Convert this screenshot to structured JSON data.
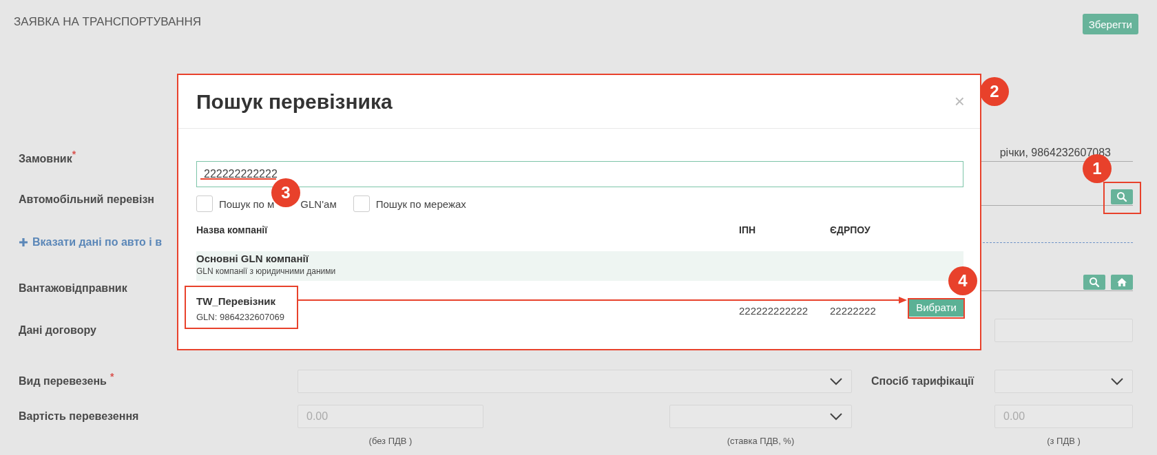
{
  "page": {
    "title": "ЗАЯВКА НА ТРАНСПОРТУВАННЯ",
    "save_button": "Зберегти"
  },
  "form": {
    "customer": {
      "label": "Замовник",
      "required_mark": "*",
      "value": "річки, 9864232607083"
    },
    "carrier": {
      "label": "Автомобільний перевізн"
    },
    "add_vehicle_link": "Вказати дані по авто і в",
    "shipper": {
      "label": "Вантажовідправник"
    },
    "contract": {
      "label": "Дані договору"
    },
    "transport_type": {
      "label": "Вид перевезень",
      "required_mark": "*",
      "side_label": "Спосіб тарифікації"
    },
    "cost": {
      "label": "Вартість перевезення",
      "net_placeholder": "0.00",
      "net_caption": "(без ПДВ )",
      "vat_caption": "(ставка ПДВ, %)",
      "gross_placeholder": "0.00",
      "gross_caption": "(з ПДВ )"
    }
  },
  "dialog": {
    "title": "Пошук перевізника",
    "close": "×",
    "search_value": "222222222222",
    "options": [
      {
        "label_parts": [
          "Пошук по м",
          "GLN'ам"
        ],
        "checked": false
      },
      {
        "label_parts": [
          "Пошук по мережах"
        ],
        "checked": false
      }
    ],
    "columns": [
      "Назва компанії",
      "ІПН",
      "ЄДРПОУ"
    ],
    "group": {
      "title": "Основні GLN компанії",
      "subtitle": "GLN компанії з юридичними даними"
    },
    "rows": [
      {
        "name": "TW_Перевізник",
        "gln": "GLN: 9864232607069",
        "ipn": "222222222222",
        "edrpou": "22222222",
        "action": "Вибрати"
      }
    ]
  },
  "annotations": [
    {
      "label": "1"
    },
    {
      "label": "2"
    },
    {
      "label": "3"
    },
    {
      "label": "4"
    }
  ]
}
